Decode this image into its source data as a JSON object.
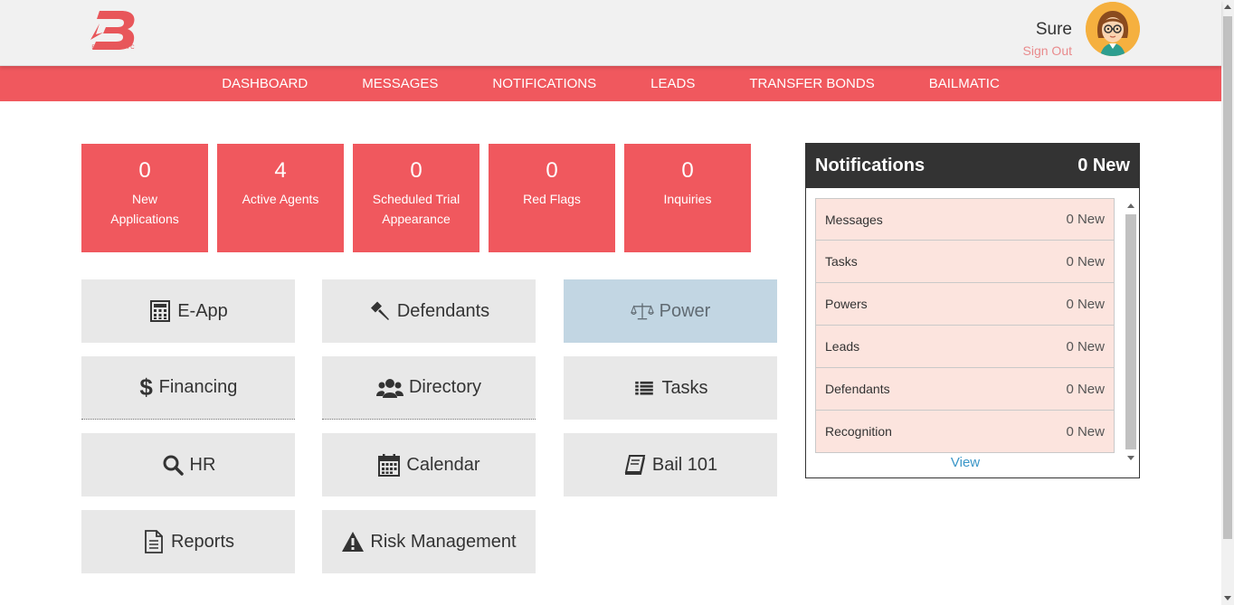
{
  "header": {
    "logo_text": "BAILMATIC",
    "user_name": "Sure",
    "sign_out": "Sign Out",
    "avatar_icon": "avatar-woman-glasses"
  },
  "nav": {
    "items": [
      "DASHBOARD",
      "MESSAGES",
      "NOTIFICATIONS",
      "LEADS",
      "TRANSFER BONDS",
      "BAILMATIC"
    ]
  },
  "stats": [
    {
      "value": "0",
      "label_1": "New",
      "label_2": "Applications"
    },
    {
      "value": "4",
      "label_1": "Active Agents",
      "label_2": ""
    },
    {
      "value": "0",
      "label_1": "Scheduled Trial",
      "label_2": "Appearance"
    },
    {
      "value": "0",
      "label_1": "Red Flags",
      "label_2": ""
    },
    {
      "value": "0",
      "label_1": "Inquiries",
      "label_2": ""
    }
  ],
  "tiles": {
    "eapp": {
      "label": "E-App",
      "icon": "calculator-icon"
    },
    "defendants": {
      "label": "Defendants",
      "icon": "gavel-icon"
    },
    "power": {
      "label": "Power",
      "icon": "scales-icon"
    },
    "financing": {
      "label": "Financing",
      "icon": "dollar-icon"
    },
    "directory": {
      "label": "Directory",
      "icon": "users-icon"
    },
    "tasks": {
      "label": "Tasks",
      "icon": "list-icon"
    },
    "hr": {
      "label": "HR",
      "icon": "search-icon"
    },
    "calendar": {
      "label": "Calendar",
      "icon": "calendar-icon"
    },
    "bail101": {
      "label": "Bail 101",
      "icon": "book-icon"
    },
    "reports": {
      "label": "Reports",
      "icon": "document-icon"
    },
    "risk": {
      "label": "Risk Management",
      "icon": "warning-icon"
    }
  },
  "notifications": {
    "title": "Notifications",
    "total": "0 New",
    "rows": [
      {
        "label": "Messages",
        "count": "0 New"
      },
      {
        "label": "Tasks",
        "count": "0 New"
      },
      {
        "label": "Powers",
        "count": "0 New"
      },
      {
        "label": "Leads",
        "count": "0 New"
      },
      {
        "label": "Defendants",
        "count": "0 New"
      },
      {
        "label": "Recognition",
        "count": "0 New"
      }
    ],
    "view_link": "View"
  },
  "colors": {
    "brand_red": "#f0585e",
    "tile_gray": "#e8e8e8",
    "power_blue": "#c2d6e3",
    "notif_row": "#fce4de",
    "link_blue": "#3a96c8"
  }
}
